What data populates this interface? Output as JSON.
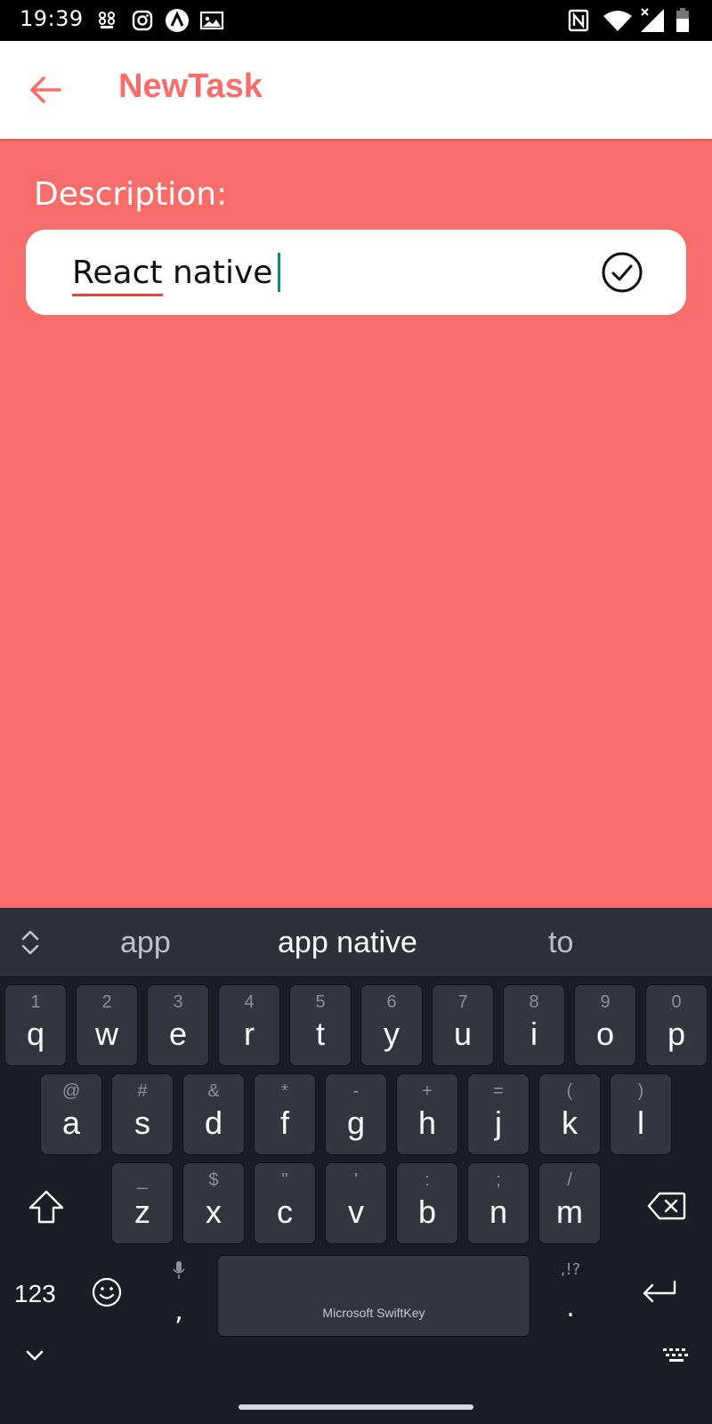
{
  "status_bar": {
    "time": "19:39",
    "left_icons": [
      "cluster-icon",
      "instagram-icon",
      "app-icon",
      "photo-icon"
    ],
    "right_icons": [
      "nfc-icon",
      "wifi-icon",
      "signal-icon",
      "battery-icon"
    ]
  },
  "app_bar": {
    "title": "NewTask",
    "back_icon": "arrow-left-icon",
    "accent_color": "#F86D6A"
  },
  "form": {
    "description_label": "Description:",
    "input_value_word1": "React",
    "input_value_word2": " native",
    "submit_icon": "check-circle-icon"
  },
  "keyboard": {
    "suggestions": [
      "app",
      "app native",
      "to"
    ],
    "rows": [
      [
        {
          "main": "q",
          "sub": "1"
        },
        {
          "main": "w",
          "sub": "2"
        },
        {
          "main": "e",
          "sub": "3"
        },
        {
          "main": "r",
          "sub": "4"
        },
        {
          "main": "t",
          "sub": "5"
        },
        {
          "main": "y",
          "sub": "6"
        },
        {
          "main": "u",
          "sub": "7"
        },
        {
          "main": "i",
          "sub": "8"
        },
        {
          "main": "o",
          "sub": "9"
        },
        {
          "main": "p",
          "sub": "0"
        }
      ],
      [
        {
          "main": "a",
          "sub": "@"
        },
        {
          "main": "s",
          "sub": "#"
        },
        {
          "main": "d",
          "sub": "&"
        },
        {
          "main": "f",
          "sub": "*"
        },
        {
          "main": "g",
          "sub": "-"
        },
        {
          "main": "h",
          "sub": "+"
        },
        {
          "main": "j",
          "sub": "="
        },
        {
          "main": "k",
          "sub": "("
        },
        {
          "main": "l",
          "sub": ")"
        }
      ],
      [
        {
          "main": "z",
          "sub": "_"
        },
        {
          "main": "x",
          "sub": "$"
        },
        {
          "main": "c",
          "sub": "\""
        },
        {
          "main": "v",
          "sub": "'"
        },
        {
          "main": "b",
          "sub": ":"
        },
        {
          "main": "n",
          "sub": ";"
        },
        {
          "main": "m",
          "sub": "/"
        }
      ]
    ],
    "numbers_label": "123",
    "comma": ",",
    "period": ".",
    "period_sub": ",!?",
    "space_label": "Microsoft SwiftKey"
  }
}
